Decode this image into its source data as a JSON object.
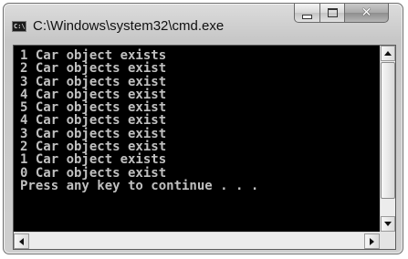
{
  "window": {
    "title": "C:\\Windows\\system32\\cmd.exe",
    "icon_text": "C:\\",
    "close_glyph": "✕"
  },
  "console": {
    "lines": [
      "1 Car object exists",
      "2 Car objects exist",
      "3 Car objects exist",
      "4 Car objects exist",
      "5 Car objects exist",
      "4 Car objects exist",
      "3 Car objects exist",
      "2 Car objects exist",
      "1 Car object exists",
      "0 Car objects exist",
      "Press any key to continue . . ."
    ]
  },
  "icons": {
    "app": "cmd-console-icon",
    "minimize": "minimize-icon",
    "maximize": "maximize-icon",
    "close": "close-icon"
  },
  "colors": {
    "console_bg": "#000000",
    "console_fg": "#c0c0c0",
    "titlebar": "#c9c9c9"
  }
}
